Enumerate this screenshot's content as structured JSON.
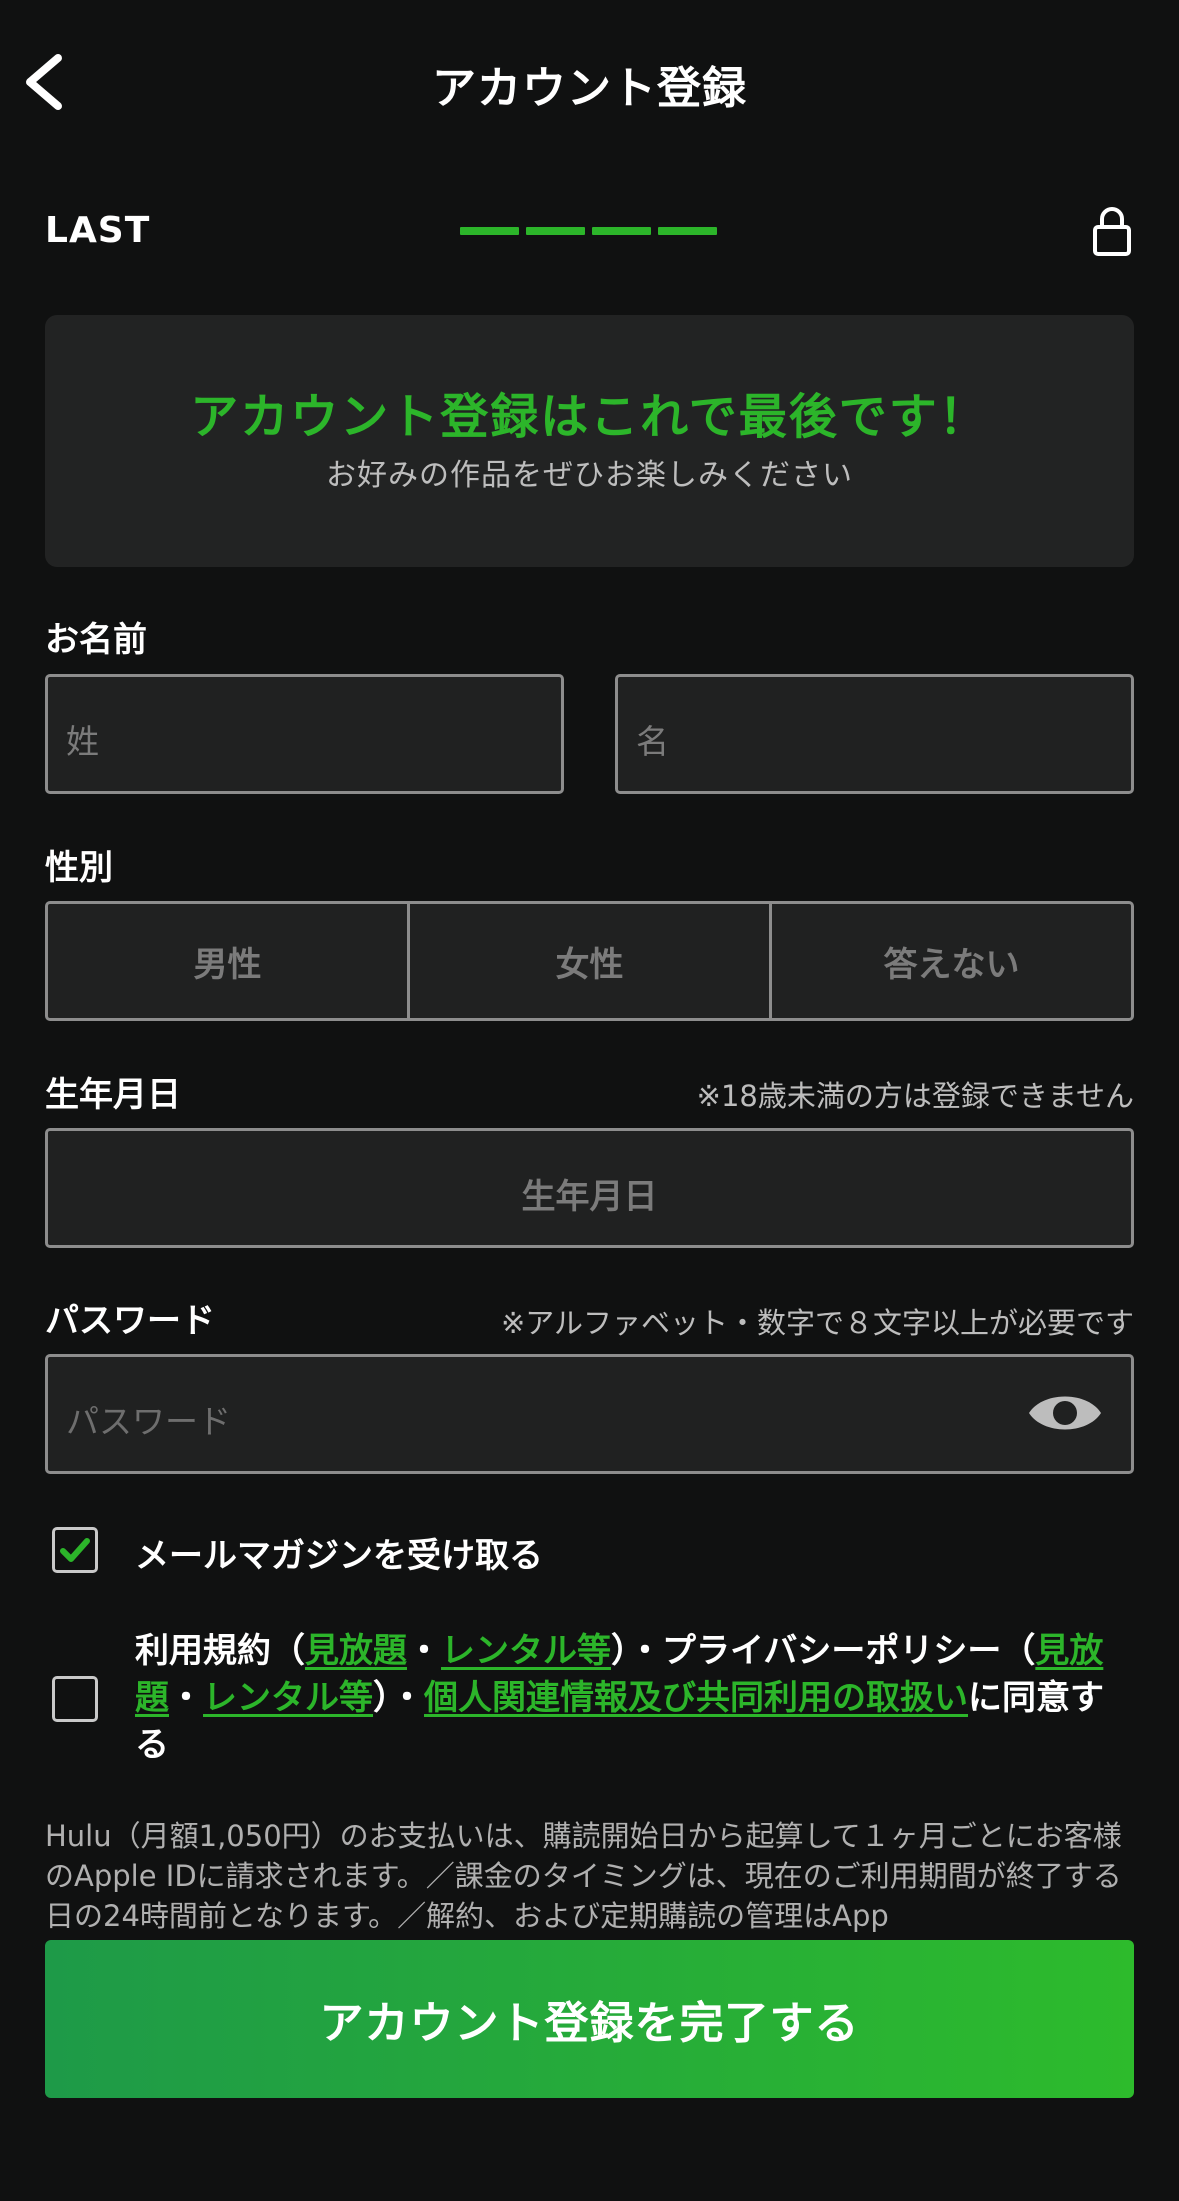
{
  "header": {
    "title": "アカウント登録",
    "back_icon": "chevron-left-icon"
  },
  "step": {
    "label": "LAST",
    "progress_segments_filled": 4,
    "progress_segments_total": 4,
    "lock_icon": "lock-icon"
  },
  "banner": {
    "title": "アカウント登録はこれで最後です！",
    "subtitle": "お好みの作品をぜひお楽しみください"
  },
  "name": {
    "label": "お名前",
    "last_placeholder": "姓",
    "first_placeholder": "名"
  },
  "gender": {
    "label": "性別",
    "options": [
      "男性",
      "女性",
      "答えない"
    ]
  },
  "birthdate": {
    "label": "生年月日",
    "note": "※18歳未満の方は登録できません",
    "placeholder": "生年月日"
  },
  "password": {
    "label": "パスワード",
    "note": "※アルファベット・数字で８文字以上が必要です",
    "placeholder": "パスワード",
    "toggle_icon": "eye-icon"
  },
  "newsletter": {
    "label": "メールマガジンを受け取る",
    "checked": true
  },
  "terms": {
    "checked": false,
    "text_1": "利用規約（",
    "link_1": "見放題",
    "sep_1": "・",
    "link_2": "レンタル等",
    "text_2": "）・プライバシーポリシー（",
    "link_3": "見放題",
    "sep_2": "・",
    "link_4": "レンタル等",
    "text_3": "）・",
    "link_5": "個人関連情報及び共同利用の取扱い",
    "text_4": "に同意する"
  },
  "disclaimer": "Hulu（月額1,050円）のお支払いは、購読開始日から起算して１ヶ月ごとにお客様のApple IDに請求されます。／課金のタイミングは、現在のご利用期間が終了する日の24時間前となります。／解約、および定期購読の管理はApp",
  "submit": {
    "label": "アカウント登録を完了する"
  },
  "colors": {
    "accent": "#2cb52a",
    "background": "#101111",
    "input_bg": "#202121",
    "border": "#8d8d8d"
  }
}
